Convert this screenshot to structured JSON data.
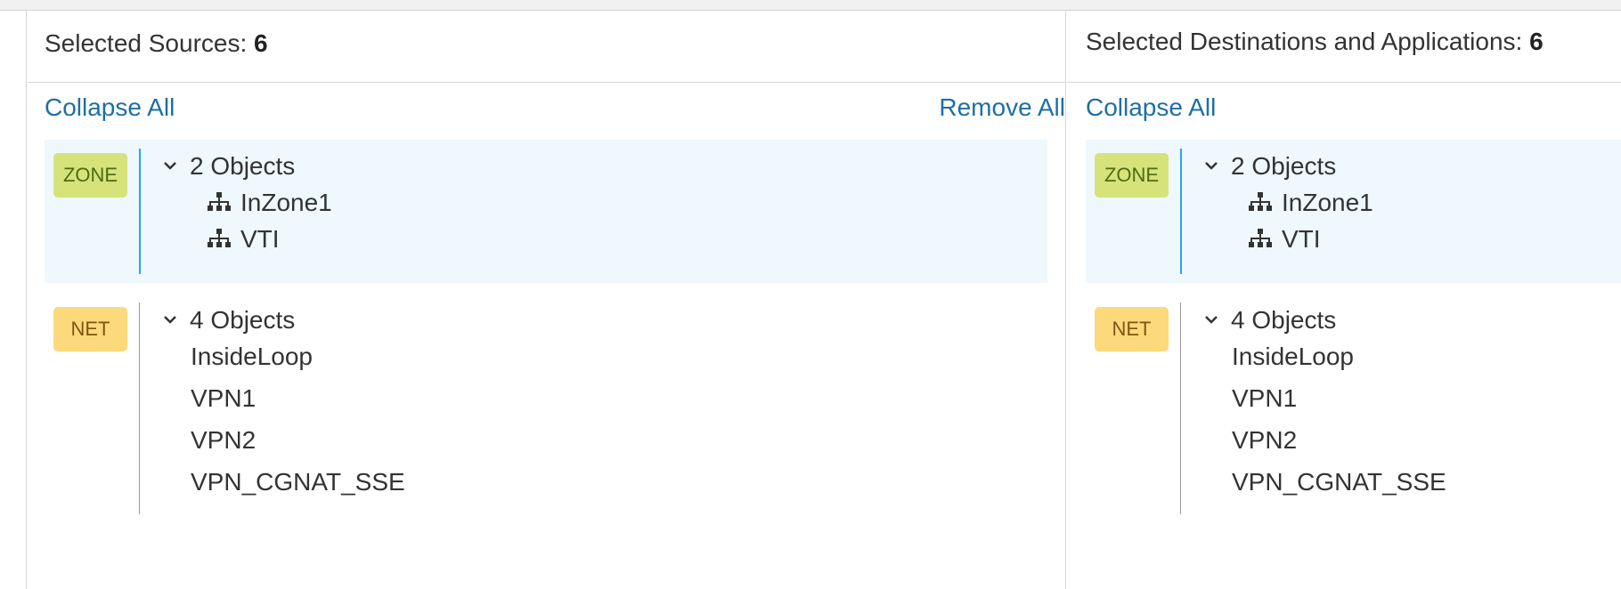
{
  "sources": {
    "title_prefix": "Selected Sources:",
    "count": "6",
    "collapse_label": "Collapse All",
    "remove_label": "Remove All",
    "zone_group": {
      "badge": "ZONE",
      "header": "2 Objects",
      "items": [
        "InZone1",
        "VTI"
      ]
    },
    "net_group": {
      "badge": "NET",
      "header": "4 Objects",
      "items": [
        "InsideLoop",
        "VPN1",
        "VPN2",
        "VPN_CGNAT_SSE"
      ]
    }
  },
  "destinations": {
    "title_prefix": "Selected Destinations and Applications:",
    "count": "6",
    "collapse_label": "Collapse All",
    "zone_group": {
      "badge": "ZONE",
      "header": "2 Objects",
      "items": [
        "InZone1",
        "VTI"
      ]
    },
    "net_group": {
      "badge": "NET",
      "header": "4 Objects",
      "items": [
        "InsideLoop",
        "VPN1",
        "VPN2",
        "VPN_CGNAT_SSE"
      ]
    }
  },
  "icons": {
    "zone_item": "network-hierarchy-icon",
    "expand": "chevron-down-icon"
  },
  "colors": {
    "link": "#1e6fa5",
    "zone_badge": "#d6e37b",
    "net_badge": "#fcd97a",
    "zone_highlight": "#eef8fd",
    "zone_line": "#29a8dd"
  }
}
